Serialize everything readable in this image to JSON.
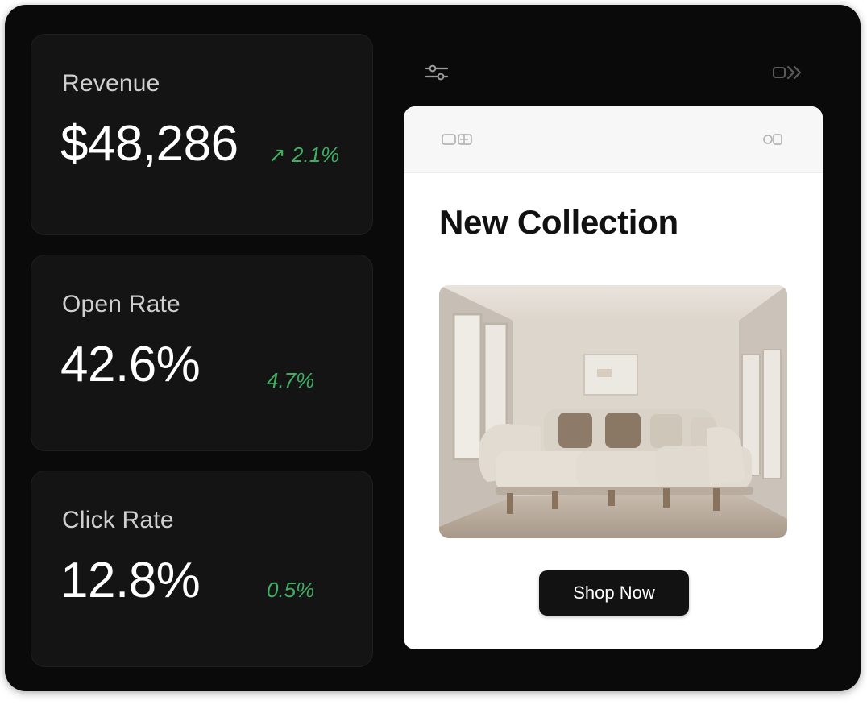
{
  "metrics": [
    {
      "label": "Revenue",
      "value": "$48,286",
      "delta": "↗ 2.1%"
    },
    {
      "label": "Open Rate",
      "value": "42.6%",
      "delta": "4.7%"
    },
    {
      "label": "Click Rate",
      "value": "12.8%",
      "delta": "0.5%"
    }
  ],
  "header": {
    "left_icon": "sliders-icon",
    "right_icon": "forward-icon"
  },
  "preview": {
    "topbar_left_icon": "window-controls-icon",
    "topbar_right_icon": "settings-icon",
    "title": "New Collection",
    "image": "living-room-sofa-image",
    "button_label": "Shop Now"
  },
  "colors": {
    "background": "#0a0a0a",
    "card": "#141414",
    "positive": "#3fae63",
    "button": "#121212"
  }
}
